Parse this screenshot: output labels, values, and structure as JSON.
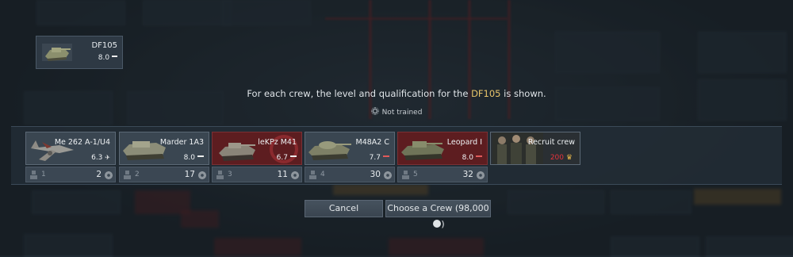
{
  "selected_vehicle": {
    "name": "DF105",
    "br": "8.0"
  },
  "info": {
    "prefix": "For each crew, the level and qualification for the",
    "vehicle": "DF105",
    "suffix": "is shown.",
    "status_text": "Not trained"
  },
  "crew_slots": [
    {
      "vehicle": "Me 262 A-1/U4",
      "br": "6.3",
      "crew_number": "1",
      "crew_level": "2",
      "style": "normal"
    },
    {
      "vehicle": "Marder 1A3",
      "br": "8.0",
      "crew_number": "2",
      "crew_level": "17",
      "style": "normal"
    },
    {
      "vehicle": "leKPz M41",
      "br": "6.7",
      "crew_number": "3",
      "crew_level": "11",
      "style": "red"
    },
    {
      "vehicle": "M48A2 C",
      "br": "7.7",
      "crew_number": "4",
      "crew_level": "30",
      "style": "normal"
    },
    {
      "vehicle": "Leopard I",
      "br": "8.0",
      "crew_number": "5",
      "crew_level": "32",
      "style": "red"
    }
  ],
  "recruit": {
    "label": "Recruit crew",
    "price": "200"
  },
  "buttons": {
    "cancel": "Cancel",
    "choose": "Choose a Crew (98,000"
  },
  "colors": {
    "highlight": "#e8c46a",
    "price": "#e5323c",
    "red_card": "#5d1d20"
  }
}
